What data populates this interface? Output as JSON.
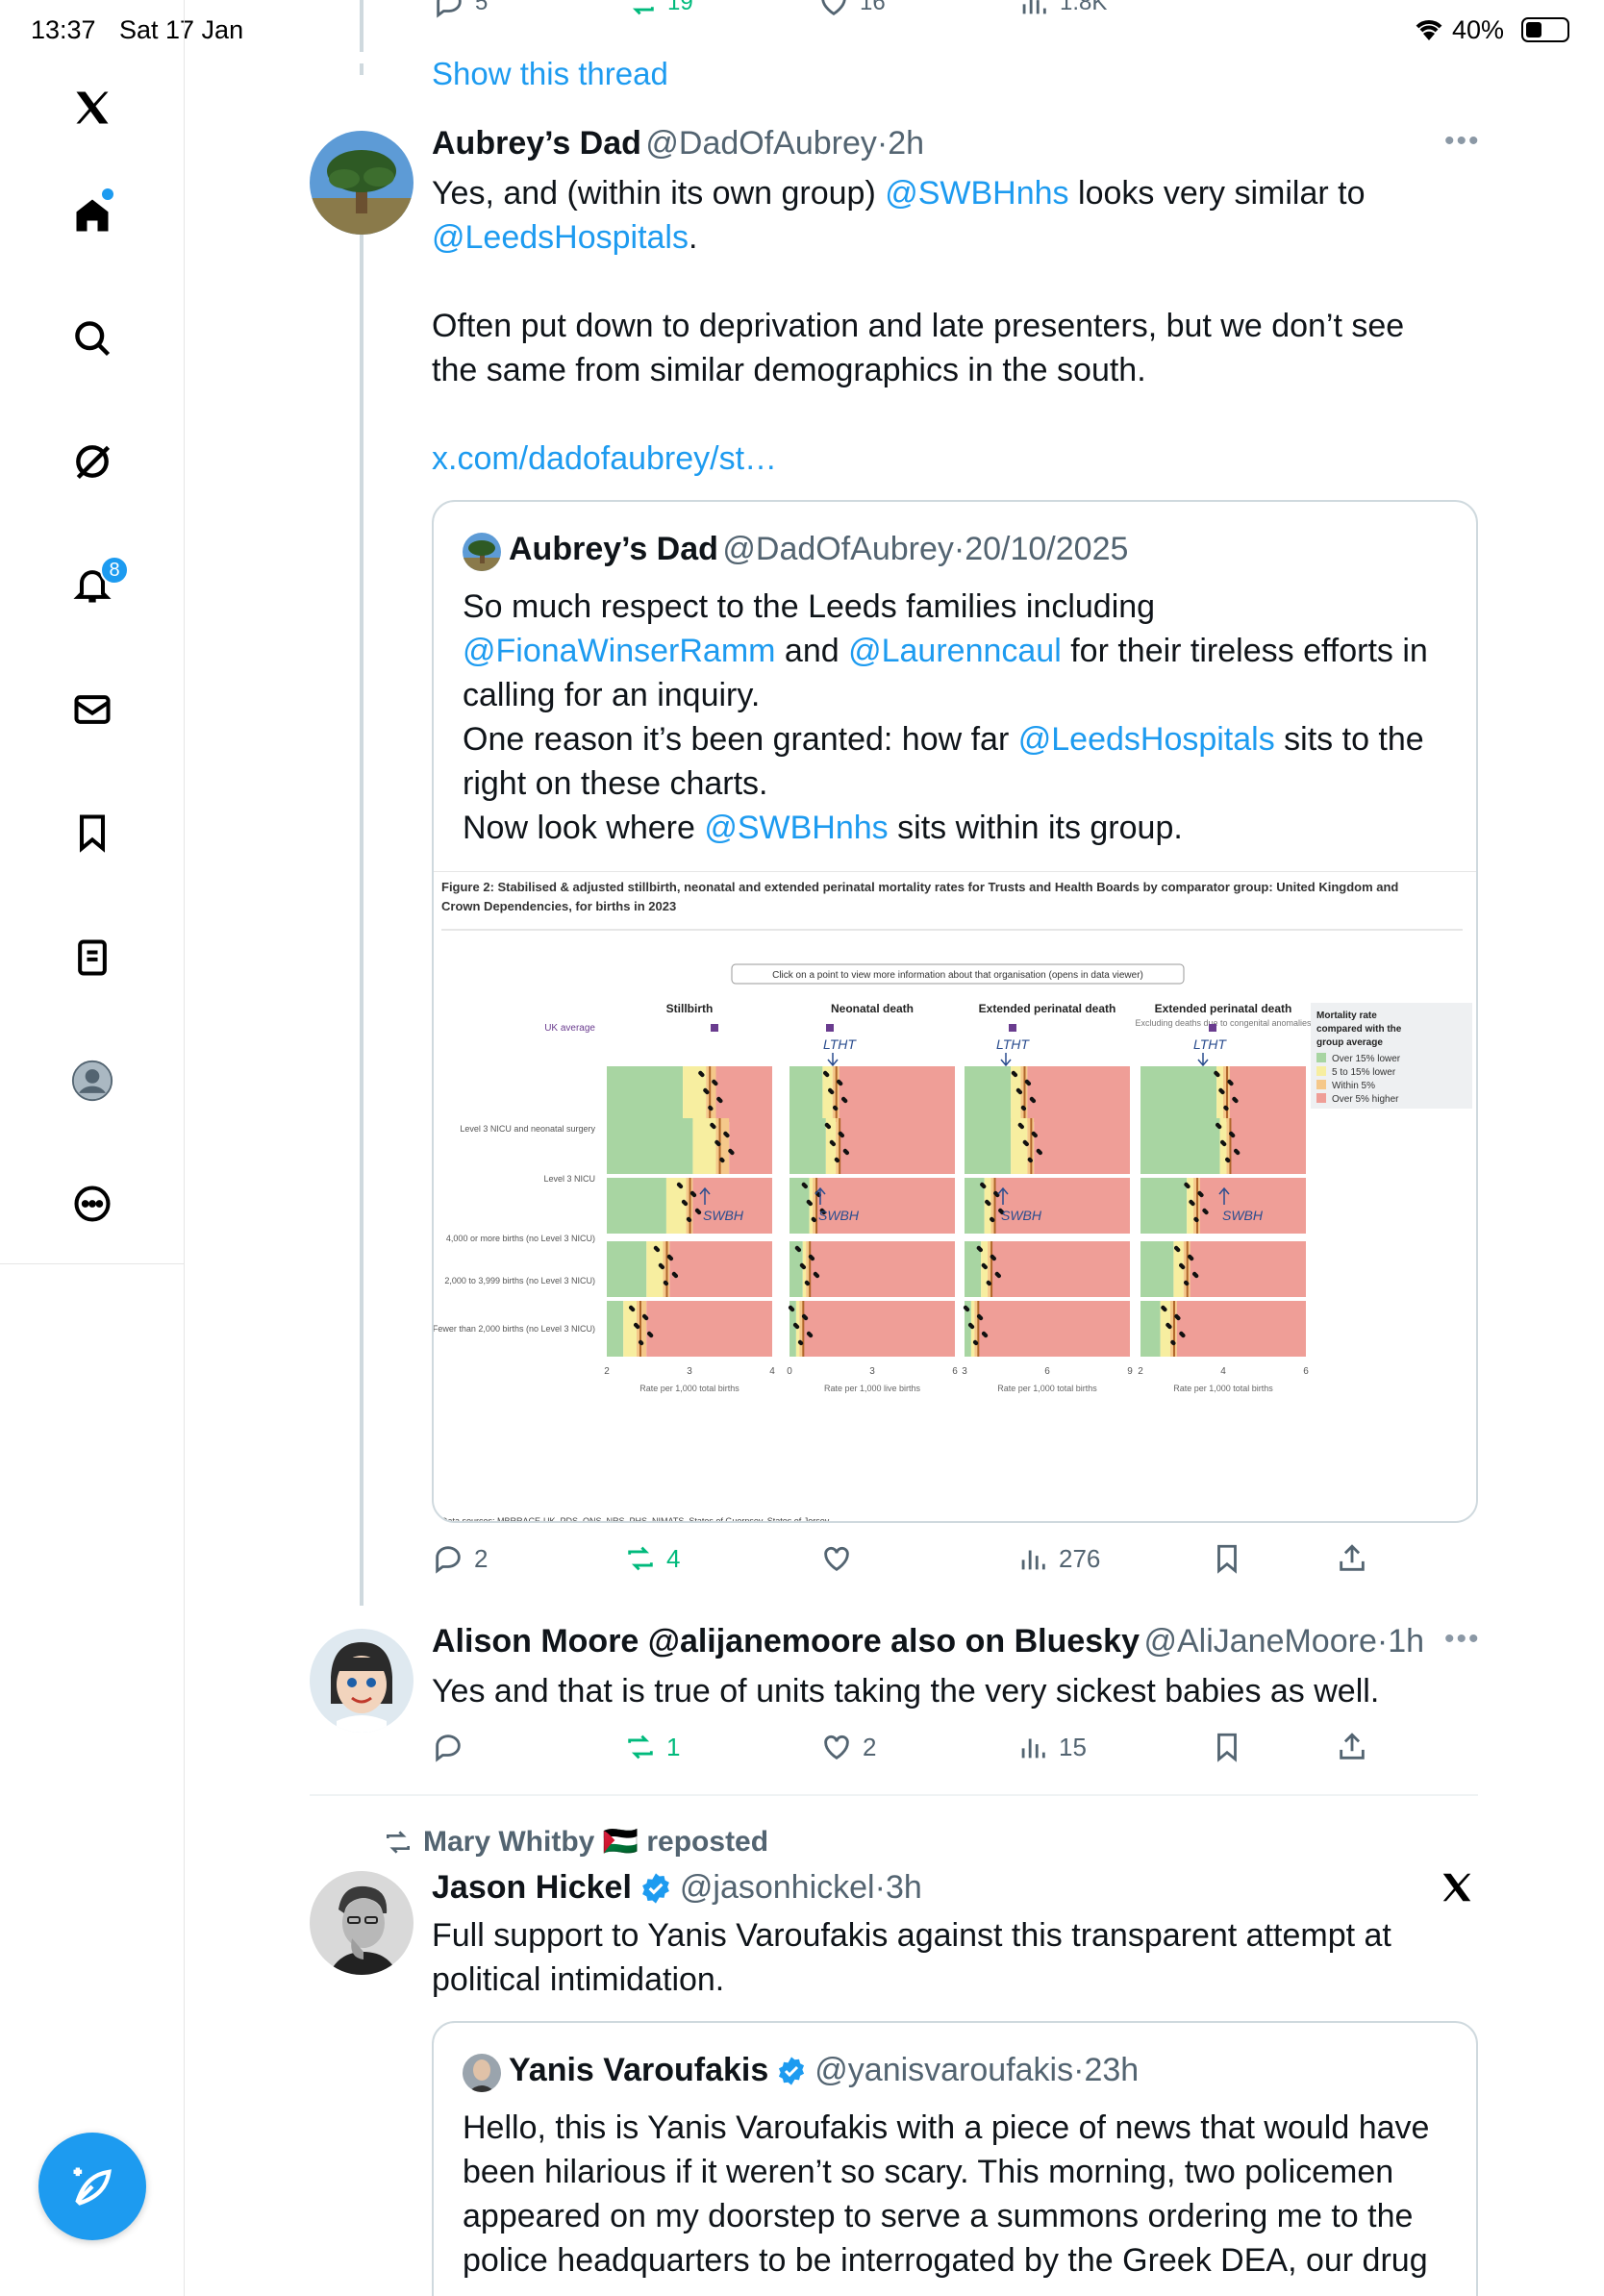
{
  "status_bar": {
    "time": "13:37",
    "date": "Sat 17 Jan",
    "battery": "40%"
  },
  "sidebar": {
    "notifications_badge": "8"
  },
  "top_actions": {
    "replies": "5",
    "reposts": "19",
    "likes": "16",
    "views": "1.8K"
  },
  "show_thread": "Show this thread",
  "tweet1": {
    "name": "Aubrey’s Dad",
    "handle": "@DadOfAubrey",
    "time": "2h",
    "p1a": "Yes, and (within its own group) ",
    "m1": "@SWBHnhs",
    "p1b": " looks very similar to",
    "m2": "@LeedsHospitals",
    "p1c": ".",
    "p2": "Often put down to deprivation and late presenters, but we don’t see the same from similar demographics in the south.",
    "link": "x.com/dadofaubrey/st…",
    "quote": {
      "name": "Aubrey’s Dad",
      "handle": "@DadOfAubrey",
      "date": "20/10/2025",
      "l1": "So much respect to the Leeds families including",
      "m1": "@FionaWinserRamm",
      "and": " and ",
      "m2": "@Laurenncaul",
      "l2b": " for their tireless efforts in calling for an inquiry.",
      "l3a": "One reason it’s been granted: how far ",
      "m3": "@LeedsHospitals",
      "l3b": "  sits to the right on these charts.",
      "l4a": "Now look where ",
      "m4": "@SWBHnhs",
      "l4b": " sits within its group."
    },
    "actions": {
      "replies": "2",
      "reposts": "4",
      "likes": "",
      "views": "276"
    }
  },
  "tweet2": {
    "name": "Alison Moore @alijanemoore also on Bluesky",
    "handle": "@AliJaneMoore",
    "time": "1h",
    "text": "Yes and that is true of units taking the very sickest babies as well.",
    "actions": {
      "replies": "",
      "reposts": "1",
      "likes": "2",
      "views": "15"
    }
  },
  "tweet3": {
    "reposted_by": "Mary Whitby 🇵🇸 reposted",
    "name": "Jason Hickel",
    "handle": "@jasonhickel",
    "time": "3h",
    "text": "Full support to Yanis Varoufakis against this transparent attempt at political intimidation.",
    "quote": {
      "name": "Yanis Varoufakis",
      "handle": "@yanisvaroufakis",
      "time": "23h",
      "text": "Hello, this is Yanis Varoufakis with a piece of news that would have been hilarious if it weren’t so scary. This morning, two policemen appeared on my doorstep to serve a summons ordering me to the police headquarters to be interrogated by the Greek DEA, our drug"
    }
  },
  "embedded_chart": {
    "figure_title": "Figure 2: Stabilised & adjusted stillbirth, neonatal and extended perinatal mortality rates for Trusts and Health Boards by comparator group: United Kingdom and Crown Dependencies, for births in 2023",
    "info_banner": "Click on a point to view more information about that organisation (opens in data viewer)",
    "panels": [
      "Stillbirth",
      "Neonatal death",
      "Extended perinatal death",
      "Extended perinatal death"
    ],
    "panel4_sub": "Excluding deaths due to congenital anomalies",
    "rows": [
      "UK average",
      "Level 3 NICU and neonatal surgery",
      "Level 3 NICU",
      "4,000 or more births (no Level 3 NICU)",
      "2,000 to 3,999 births (no Level 3 NICU)",
      "Fewer than 2,000 births (no Level 3 NICU)"
    ],
    "legend_title": "Mortality rate compared with the group average",
    "legend": [
      "Over 15% lower",
      "5 to 15% lower",
      "Within 5%",
      "Over 5% higher"
    ],
    "legend_colors": [
      "#a8d5a2",
      "#f7eea0",
      "#f5c88a",
      "#ef9e97"
    ],
    "x_ticks": [
      [
        "2",
        "3",
        "4"
      ],
      [
        "0",
        "3",
        "6"
      ],
      [
        "3",
        "6",
        "9"
      ],
      [
        "2",
        "4",
        "6"
      ]
    ],
    "x_labels": [
      "Rate per 1,000 total births",
      "Rate per 1,000 live births",
      "Rate per 1,000 total births",
      "Rate per 1,000 total births"
    ],
    "annotations": [
      "LTHT",
      "SWBH"
    ],
    "source": "Data sources: MBRRACE-UK, PDS, ONS, NRS, PHS, NIMATS, States of Guernsey, States of Jersey"
  }
}
